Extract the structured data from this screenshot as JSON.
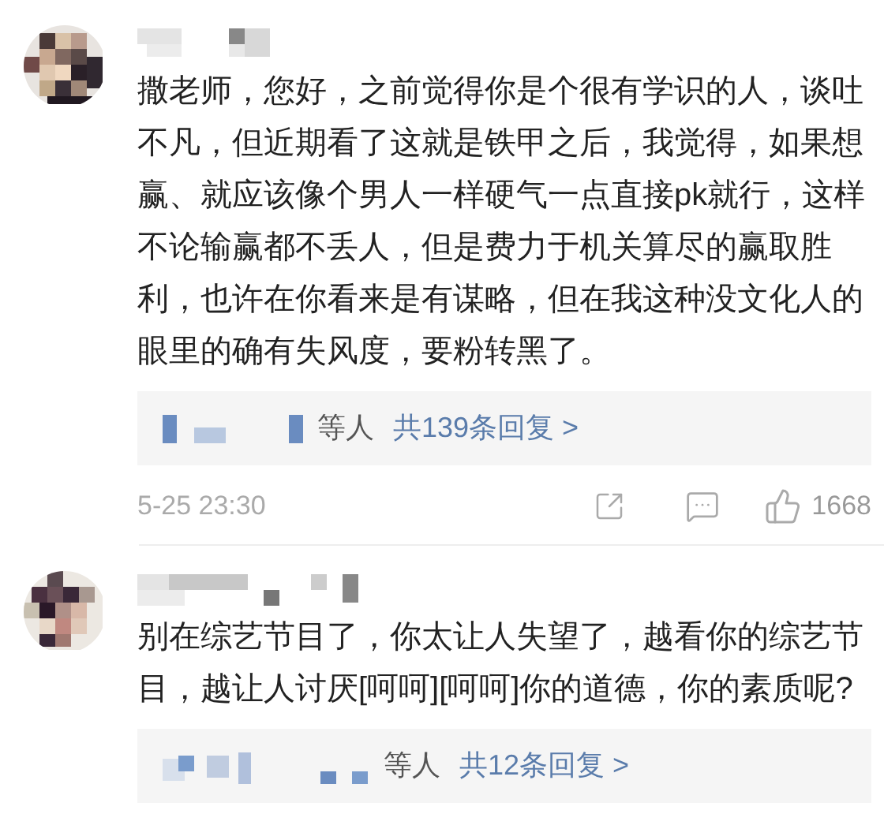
{
  "comments": [
    {
      "text": "撒老师，您好，之前觉得你是个很有学识的人，谈吐不凡，但近期看了这就是铁甲之后，我觉得，如果想赢、就应该像个男人一样硬气一点直接pk就行，这样不论输赢都不丢人，但是费力于机关算尽的赢取胜利，也许在你看来是有谋略，但在我这种没文化人的眼里的确有失风度，要粉转黑了。",
      "replies": {
        "suffix": "等人",
        "link": "共139条回复 >"
      },
      "footer": {
        "time": "5-25 23:30",
        "likes": "1668"
      }
    },
    {
      "text": "别在综艺节目了，你太让人失望了，越看你的综艺节目，越让人讨厌[呵呵][呵呵]你的道德，你的素质呢?",
      "replies": {
        "suffix": "等人",
        "link": "共12条回复 >"
      }
    }
  ]
}
